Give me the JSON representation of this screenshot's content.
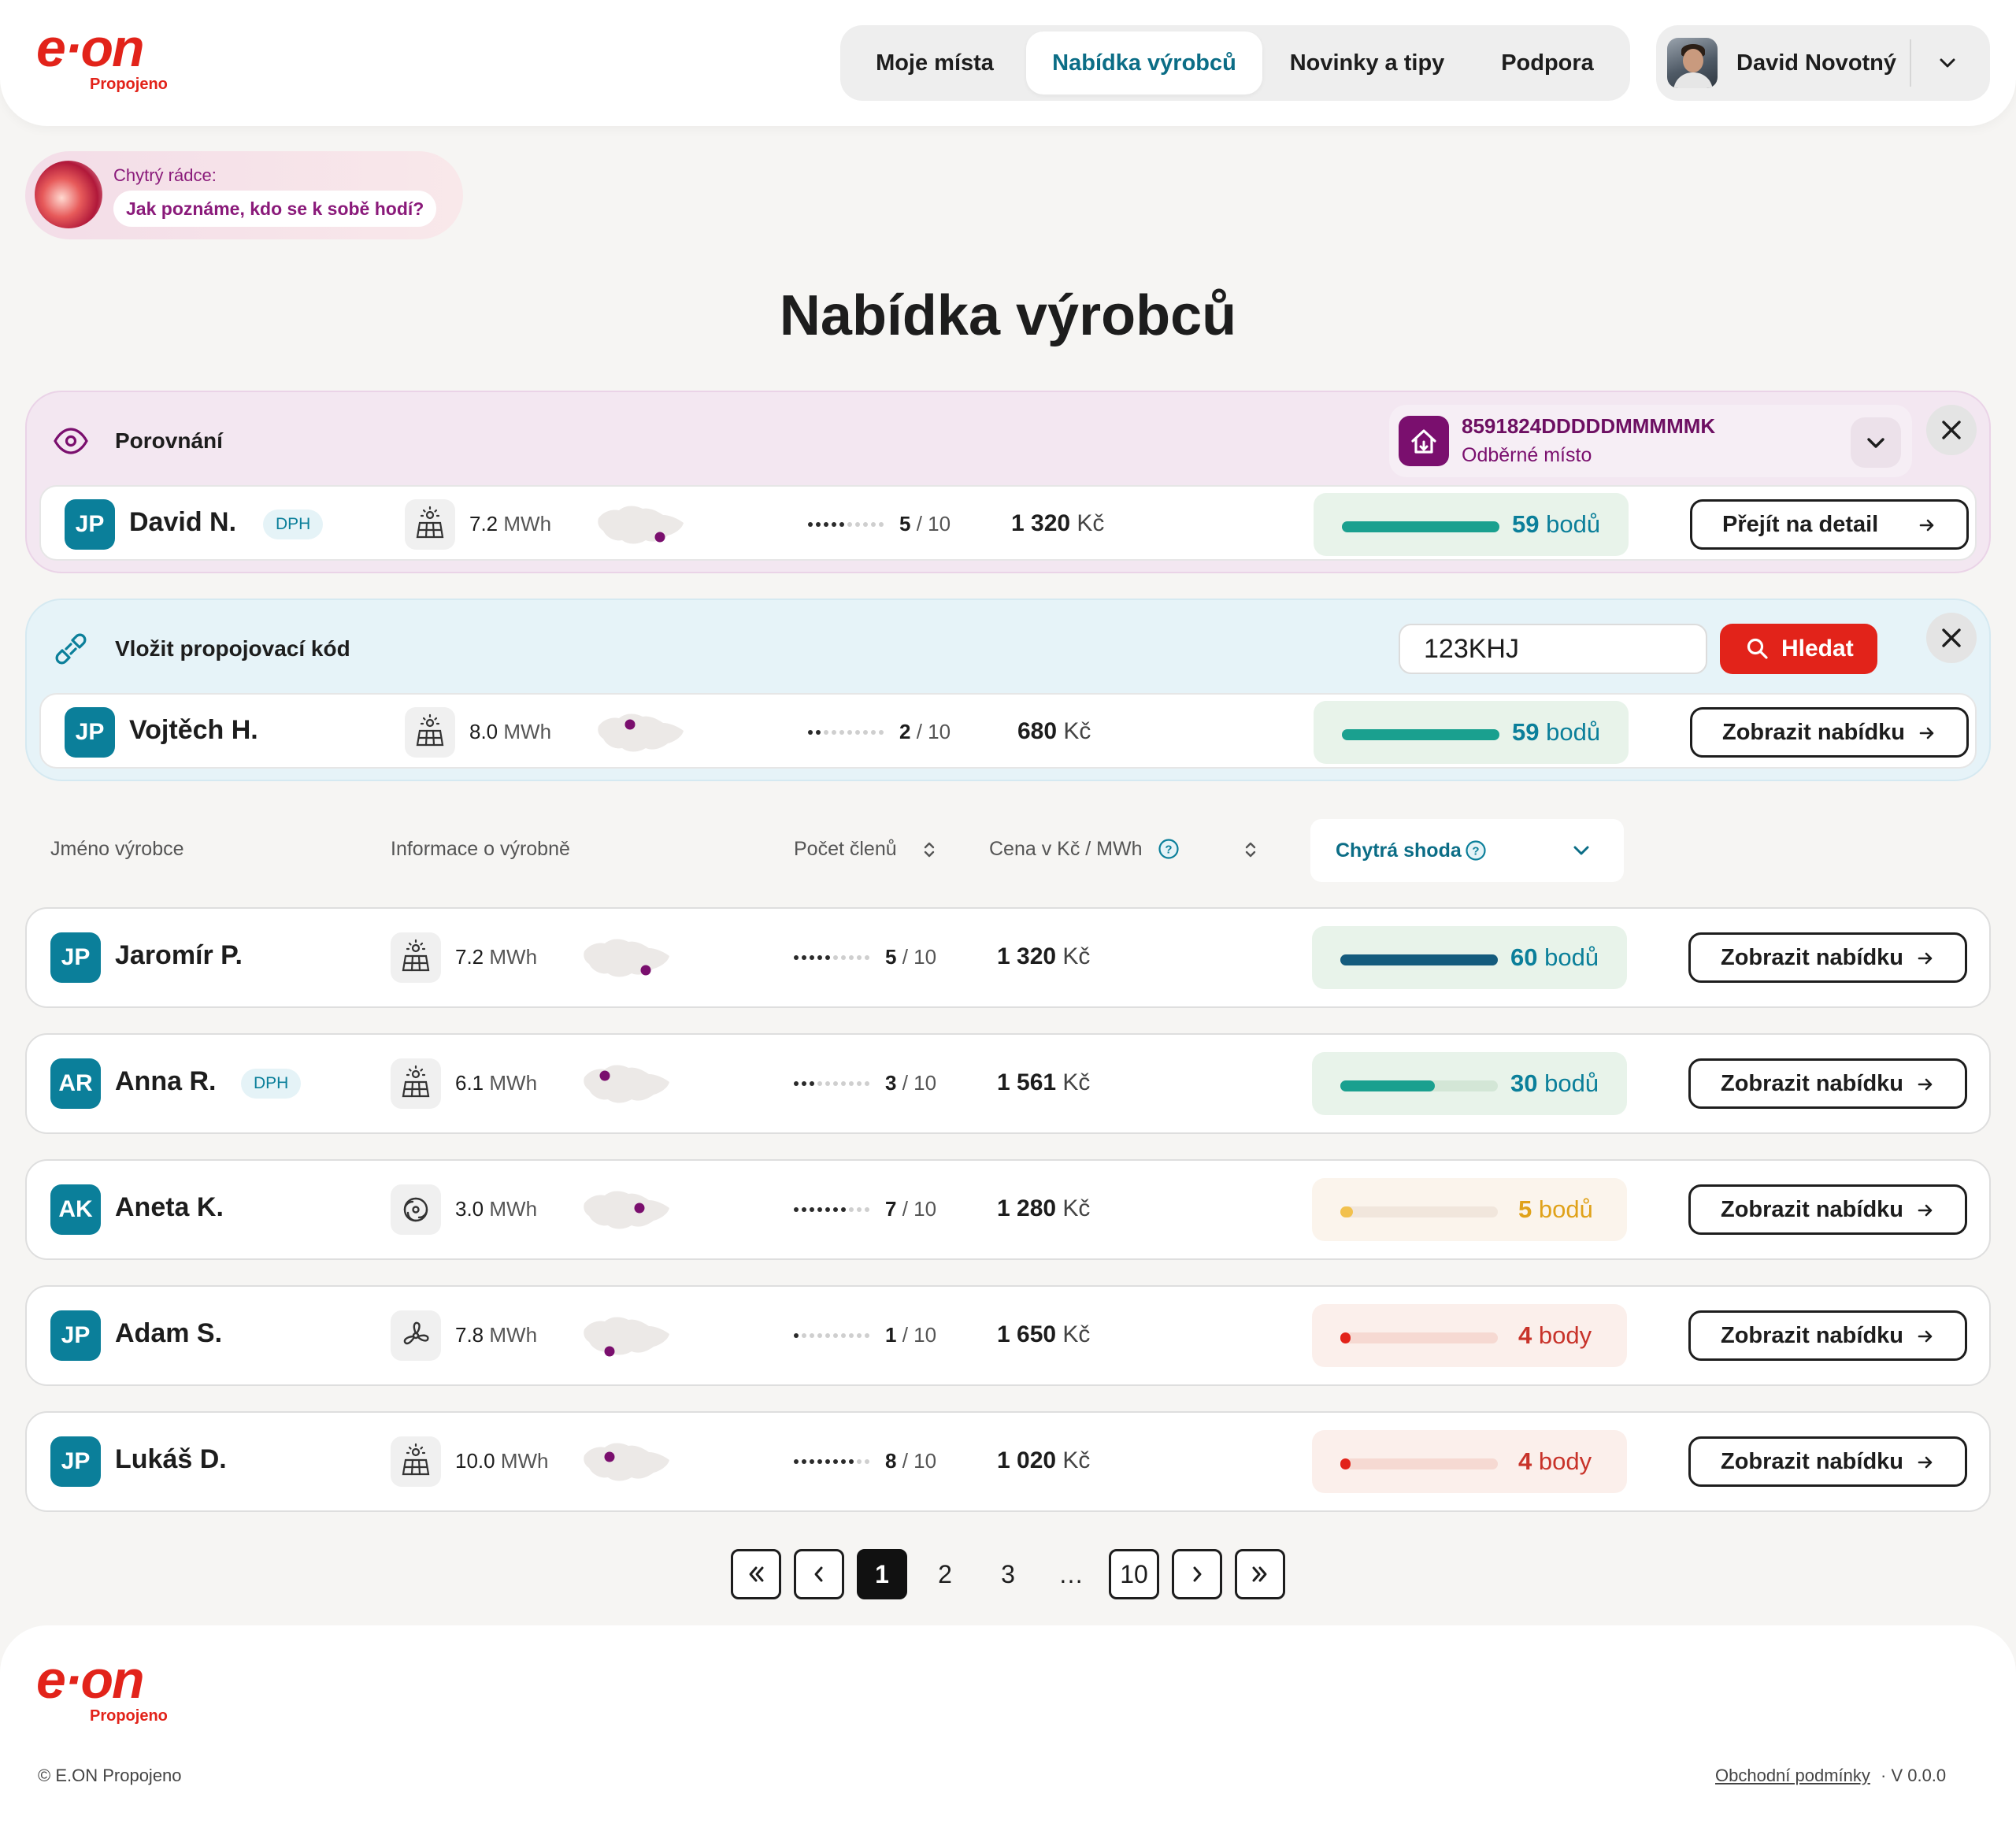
{
  "brand": {
    "logo_text": "e·on",
    "sub": "Propojeno"
  },
  "nav": {
    "items": [
      "Moje místa",
      "Nabídka výrobců",
      "Novinky a tipy",
      "Podpora"
    ],
    "active": "Nabídka výrobců"
  },
  "user": {
    "name": "David Novotný"
  },
  "advisor": {
    "label": "Chytrý rádce:",
    "question": "Jak poznáme, kdo se k sobě hodí?"
  },
  "page_title": "Nabídka výrobců",
  "compare": {
    "title": "Porovnání",
    "place_number": "8591824DDDDDMMMMMK",
    "place_label": "Odběrné místo",
    "row": {
      "initials": "JP",
      "name": "David N.",
      "badge": "DPH",
      "tech": "solar-icon",
      "mwh_value": "7.2",
      "mwh_unit": "MWh",
      "members": 5,
      "members_text": "5",
      "members_total_text": "/ 10",
      "price_value": "1 320",
      "price_unit": "Kč",
      "score": 59,
      "score_num": "59",
      "score_word": "bodů",
      "action": "Přejít na detail"
    }
  },
  "code": {
    "title": "Vložit propojovací kód",
    "input_value": "123KHJ",
    "search_label": "Hledat",
    "row": {
      "initials": "JP",
      "name": "Vojtěch H.",
      "tech": "solar-icon",
      "mwh_value": "8.0",
      "mwh_unit": "MWh",
      "members": 2,
      "members_text": "2",
      "members_total_text": "/ 10",
      "price_value": "680",
      "price_unit": "Kč",
      "score": 59,
      "score_num": "59",
      "score_word": "bodů",
      "action": "Zobrazit nabídku"
    }
  },
  "table": {
    "headers": {
      "name": "Jméno výrobce",
      "info": "Informace o výrobně",
      "members": "Počet členů",
      "price": "Cena v Kč / MWh",
      "smart": "Chytrá shoda"
    },
    "rows": [
      {
        "initials": "JP",
        "name": "Jaromír P.",
        "tech": "solar-icon",
        "mwh_value": "7.2",
        "mwh_unit": "MWh",
        "members": 5,
        "members_text": "5",
        "members_total_text": "/ 10",
        "price_value": "1 320",
        "price_unit": "Kč",
        "score": 60,
        "score_num": "60",
        "score_word": "bodů",
        "action": "Zobrazit nabídku"
      },
      {
        "initials": "AR",
        "name": "Anna R.",
        "badge": "DPH",
        "tech": "solar-icon",
        "mwh_value": "6.1",
        "mwh_unit": "MWh",
        "members": 3,
        "members_text": "3",
        "members_total_text": "/ 10",
        "price_value": "1 561",
        "price_unit": "Kč",
        "score": 30,
        "score_num": "30",
        "score_word": "bodů",
        "action": "Zobrazit nabídku"
      },
      {
        "initials": "AK",
        "name": "Aneta K.",
        "tech": "water-icon",
        "mwh_value": "3.0",
        "mwh_unit": "MWh",
        "members": 7,
        "members_text": "7",
        "members_total_text": "/ 10",
        "price_value": "1 280",
        "price_unit": "Kč",
        "score": 5,
        "score_num": "5",
        "score_word": "bodů",
        "action": "Zobrazit nabídku"
      },
      {
        "initials": "JP",
        "name": "Adam S.",
        "tech": "wind-icon",
        "mwh_value": "7.8",
        "mwh_unit": "MWh",
        "members": 1,
        "members_text": "1",
        "members_total_text": "/ 10",
        "price_value": "1 650",
        "price_unit": "Kč",
        "score": 4,
        "score_num": "4",
        "score_word": "body",
        "action": "Zobrazit nabídku"
      },
      {
        "initials": "JP",
        "name": "Lukáš D.",
        "tech": "solar-icon",
        "mwh_value": "10.0",
        "mwh_unit": "MWh",
        "members": 8,
        "members_text": "8",
        "members_total_text": "/ 10",
        "price_value": "1 020",
        "price_unit": "Kč",
        "score": 4,
        "score_num": "4",
        "score_word": "body",
        "action": "Zobrazit nabídku"
      }
    ]
  },
  "pagination": {
    "pages": [
      "1",
      "2",
      "3",
      "…",
      "10"
    ],
    "current": "1"
  },
  "footer": {
    "logo_text": "e·on",
    "sub": "Propojeno",
    "copyright": "© E.ON Propojeno",
    "terms": "Obchodní podmínky",
    "version": "· V 0.0.0"
  },
  "colors": {
    "brand_red": "#e2231a",
    "teal": "#0b7f9a",
    "purple": "#7a0f6e"
  }
}
